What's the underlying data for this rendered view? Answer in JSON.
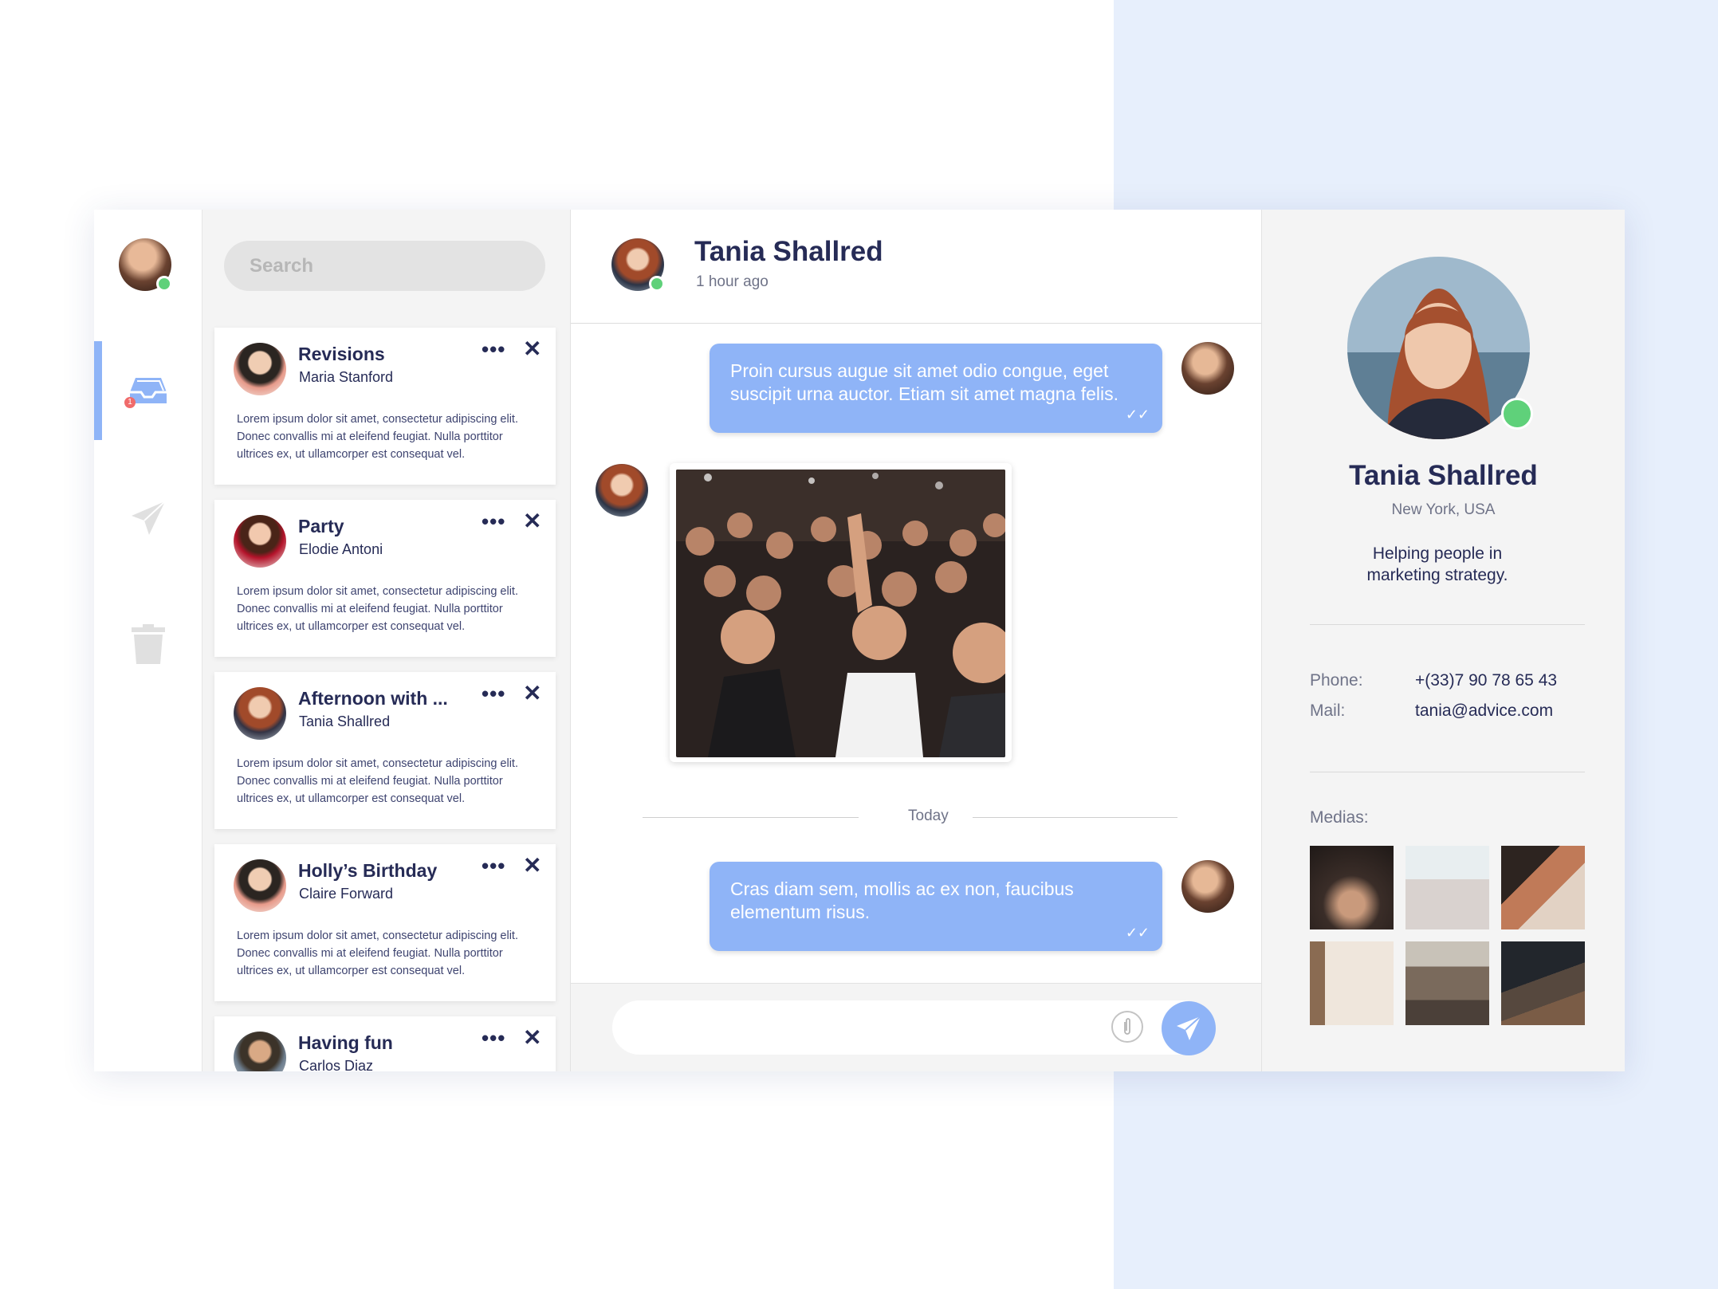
{
  "search": {
    "placeholder": "Search"
  },
  "sidebar": {
    "icons": [
      "inbox-icon",
      "send-icon",
      "trash-icon"
    ],
    "inbox_badge": "1"
  },
  "conversations": [
    {
      "title": "Revisions",
      "sender": "Maria Stanford",
      "body": "Lorem ipsum dolor sit amet, consectetur adipiscing elit. Donec convallis mi at eleifend feugiat. Nulla porttitor ultrices ex, ut ullamcorper est consequat vel.",
      "more": "•••",
      "close": "✕"
    },
    {
      "title": "Party",
      "sender": "Elodie Antoni",
      "body": "Lorem ipsum dolor sit amet, consectetur adipiscing elit. Donec convallis mi at eleifend feugiat. Nulla porttitor ultrices ex, ut ullamcorper est consequat vel.",
      "more": "•••",
      "close": "✕"
    },
    {
      "title": "Afternoon with ...",
      "sender": "Tania Shallred",
      "body": "Lorem ipsum dolor sit amet, consectetur adipiscing elit. Donec convallis mi at eleifend feugiat. Nulla porttitor ultrices ex, ut ullamcorper est consequat vel.",
      "more": "•••",
      "close": "✕"
    },
    {
      "title": "Holly’s Birthday",
      "sender": "Claire Forward",
      "body": "Lorem ipsum dolor sit amet, consectetur adipiscing elit. Donec convallis mi at eleifend feugiat. Nulla porttitor ultrices ex, ut ullamcorper est consequat vel.",
      "more": "•••",
      "close": "✕"
    },
    {
      "title": "Having fun",
      "sender": "Carlos Diaz",
      "body": "",
      "more": "•••",
      "close": "✕"
    }
  ],
  "chat": {
    "name": "Tania Shallred",
    "status": "1 hour ago",
    "messages": [
      {
        "text": "Proin cursus augue sit amet odio congue, eget suscipit urna auctor. Etiam sit amet magna felis.",
        "ticks": "✓✓"
      },
      {
        "text": "Cras diam sem, mollis ac ex non, faucibus elementum risus.",
        "ticks": "✓✓"
      }
    ],
    "divider": "Today",
    "attach_icon": "paperclip-icon",
    "send_icon": "send-icon"
  },
  "profile": {
    "name": "Tania Shallred",
    "location": "New York, USA",
    "bio": "Helping people in marketing strategy.",
    "phone_label": "Phone:",
    "phone": "+(33)7 90 78 65 43",
    "mail_label": "Mail:",
    "mail": "tania@advice.com",
    "medias_label": "Medias:"
  },
  "colors": {
    "accent": "#8fb4f7",
    "online": "#5fd17a",
    "badge": "#f06b6b",
    "text": "#262b56",
    "backdrop": "#e7effc"
  }
}
